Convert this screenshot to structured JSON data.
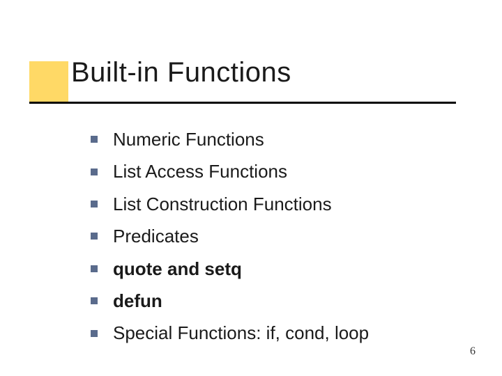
{
  "title": "Built-in Functions",
  "bullets": [
    {
      "text": "Numeric Functions",
      "bold": false
    },
    {
      "text": "List Access Functions",
      "bold": false
    },
    {
      "text": "List Construction Functions",
      "bold": false
    },
    {
      "text": "Predicates",
      "bold": false
    },
    {
      "text": "quote and setq",
      "bold": true
    },
    {
      "text": "defun",
      "bold": true
    },
    {
      "text": "Special Functions:  if, cond, loop",
      "bold": false
    }
  ],
  "page_number": "6"
}
